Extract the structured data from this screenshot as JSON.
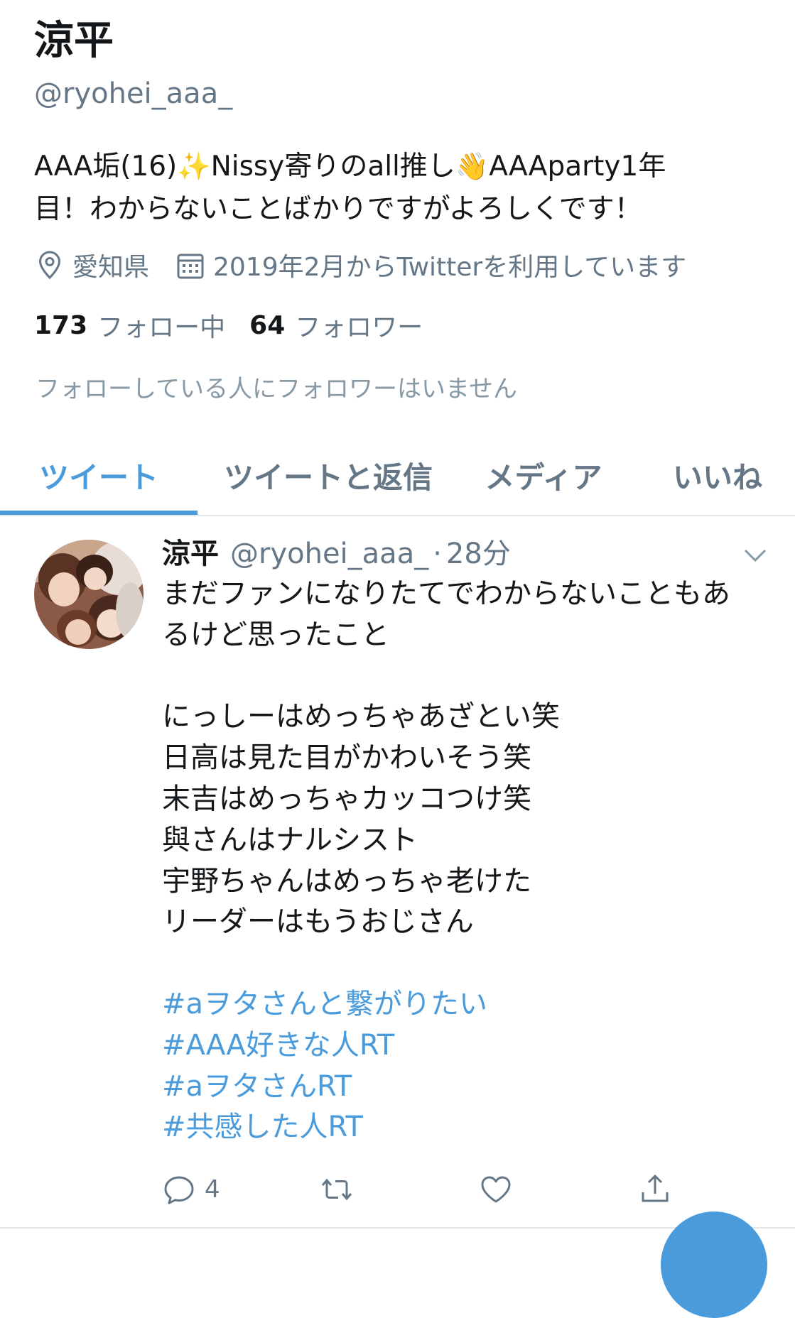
{
  "profile": {
    "name": "涼平",
    "handle": "@ryohei_aaa_",
    "bio": {
      "part1": "AAA垢(16)",
      "emoji1": "✨",
      "part2": "Nissy寄りのall推し",
      "emoji2": "👋",
      "part3": "AAAparty1年",
      "line2": "目！わからないことばかりですがよろしくです！"
    },
    "location": "愛知県",
    "joined": "2019年2月からTwitterを利用しています",
    "following_count": "173",
    "following_label": "フォロー中",
    "followers_count": "64",
    "followers_label": "フォロワー",
    "followed_by_note": "フォローしている人にフォロワーはいません"
  },
  "tabs": [
    {
      "label": "ツイート",
      "active": true
    },
    {
      "label": "ツイートと返信",
      "active": false
    },
    {
      "label": "メディア",
      "active": false
    },
    {
      "label": "いいね",
      "active": false
    }
  ],
  "tweet": {
    "author_name": "涼平",
    "author_handle": "@ryohei_aaa_",
    "separator": "·",
    "time": "28分",
    "lines": [
      "まだファンになりたてでわからないこともあ",
      "るけど思ったこと",
      "",
      "にっしーはめっちゃあざとい笑",
      "日高は見た目がかわいそう笑",
      "末吉はめっちゃカッコつけ笑",
      "與さんはナルシスト",
      "宇野ちゃんはめっちゃ老けた",
      "リーダーはもうおじさん",
      ""
    ],
    "hashtags": [
      "#aヲタさんと繋がりたい",
      "#AAA好きな人RT",
      "#aヲタさんRT",
      "#共感した人RT"
    ],
    "reply_count": "4"
  },
  "icons": {
    "location": "location-pin-icon",
    "calendar": "calendar-icon",
    "reply": "reply-icon",
    "retweet": "retweet-icon",
    "like": "heart-icon",
    "share": "share-icon",
    "menu": "chevron-down-icon"
  },
  "colors": {
    "accent": "#4a9bdc",
    "secondary_text": "#657786",
    "primary_text": "#14171a"
  }
}
